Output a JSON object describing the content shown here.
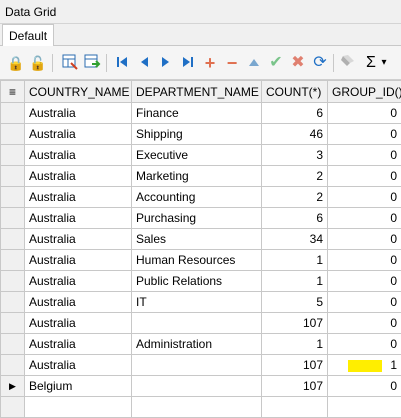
{
  "window": {
    "title": "Data Grid"
  },
  "tabs": [
    {
      "label": "Default"
    }
  ],
  "toolbar": {
    "icons": [
      "lock-icon",
      "lock-icon",
      "export-icon",
      "import-icon",
      "first-icon",
      "prev-icon",
      "next-icon",
      "last-icon",
      "add-icon",
      "remove-icon",
      "up-icon",
      "check-icon",
      "cancel-icon",
      "refresh-icon",
      "clear-icon",
      "sum-icon"
    ],
    "sum_glyph": "Σ",
    "dropdown_glyph": "▾"
  },
  "grid": {
    "columns": [
      "COUNTRY_NAME",
      "DEPARTMENT_NAME",
      "COUNT(*)",
      "GROUP_ID()"
    ],
    "rows": [
      {
        "country": "Australia",
        "department": "Finance",
        "count": "6",
        "group_id": "0"
      },
      {
        "country": "Australia",
        "department": "Shipping",
        "count": "46",
        "group_id": "0"
      },
      {
        "country": "Australia",
        "department": "Executive",
        "count": "3",
        "group_id": "0"
      },
      {
        "country": "Australia",
        "department": "Marketing",
        "count": "2",
        "group_id": "0"
      },
      {
        "country": "Australia",
        "department": "Accounting",
        "count": "2",
        "group_id": "0"
      },
      {
        "country": "Australia",
        "department": "Purchasing",
        "count": "6",
        "group_id": "0"
      },
      {
        "country": "Australia",
        "department": "Sales",
        "count": "34",
        "group_id": "0"
      },
      {
        "country": "Australia",
        "department": "Human Resources",
        "count": "1",
        "group_id": "0"
      },
      {
        "country": "Australia",
        "department": "Public Relations",
        "count": "1",
        "group_id": "0"
      },
      {
        "country": "Australia",
        "department": "IT",
        "count": "5",
        "group_id": "0"
      },
      {
        "country": "Australia",
        "department": "",
        "count": "107",
        "group_id": "0"
      },
      {
        "country": "Australia",
        "department": "Administration",
        "count": "1",
        "group_id": "0"
      },
      {
        "country": "Australia",
        "department": "",
        "count": "107",
        "group_id": "1"
      },
      {
        "country": "Belgium",
        "department": "",
        "count": "107",
        "group_id": "0"
      },
      {
        "country": "",
        "department": "",
        "count": "",
        "group_id": ""
      }
    ],
    "highlight_color": "#ffee00",
    "current_row_marker": "▶"
  }
}
